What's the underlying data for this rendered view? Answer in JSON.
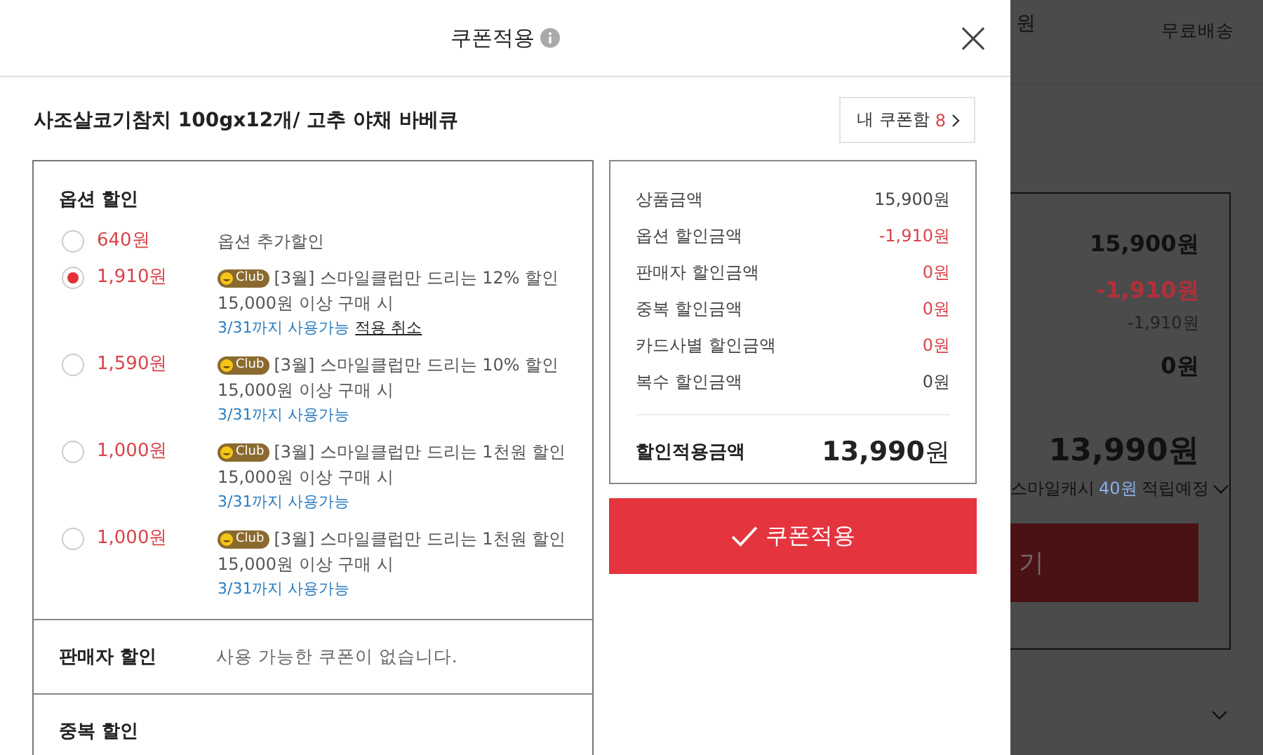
{
  "modal": {
    "title": "쿠폰적용"
  },
  "product": {
    "name": "사조살코기참치 100gx12개/ 고추 야채 바베큐",
    "coupon_box": {
      "label": "내 쿠폰함",
      "count": "8"
    }
  },
  "option_discount": {
    "title": "옵션 할인",
    "coupons": [
      {
        "kind": "plain",
        "selected": false,
        "amount": "640원",
        "name": "옵션 추가할인"
      },
      {
        "kind": "club",
        "selected": true,
        "amount": "1,910원",
        "badge": "Club",
        "name": "[3월] 스마일클럽만 드리는 12% 할인",
        "condition": "15,000원 이상 구매 시",
        "validity": "3/31까지 사용가능",
        "cancel_link": "적용 취소"
      },
      {
        "kind": "club",
        "selected": false,
        "amount": "1,590원",
        "badge": "Club",
        "name": "[3월] 스마일클럽만 드리는 10% 할인",
        "condition": "15,000원 이상 구매 시",
        "validity": "3/31까지 사용가능"
      },
      {
        "kind": "club",
        "selected": false,
        "amount": "1,000원",
        "badge": "Club",
        "name": "[3월] 스마일클럽만 드리는 1천원 할인",
        "condition": "15,000원 이상 구매 시",
        "validity": "3/31까지 사용가능"
      },
      {
        "kind": "club",
        "selected": false,
        "amount": "1,000원",
        "badge": "Club",
        "name": "[3월] 스마일클럽만 드리는 1천원 할인",
        "condition": "15,000원 이상 구매 시",
        "validity": "3/31까지 사용가능"
      }
    ]
  },
  "seller_discount": {
    "title": "판매자 할인",
    "message": "사용 가능한 쿠폰이 없습니다."
  },
  "duplicate_discount": {
    "title": "중복 할인"
  },
  "summary": {
    "rows": [
      {
        "label": "상품금액",
        "value": "15,900원",
        "highlight": false
      },
      {
        "label": "옵션 할인금액",
        "value": "-1,910원",
        "highlight": true
      },
      {
        "label": "판매자 할인금액",
        "value": "0원",
        "highlight": true
      },
      {
        "label": "중복 할인금액",
        "value": "0원",
        "highlight": true
      },
      {
        "label": "카드사별 할인금액",
        "value": "0원",
        "highlight": true
      },
      {
        "label": "복수 할인금액",
        "value": "0원",
        "highlight": false
      }
    ],
    "total": {
      "label": "할인적용금액",
      "amount": "13,990",
      "unit": "원"
    }
  },
  "apply_button": {
    "label": "쿠폰적용"
  },
  "background": {
    "header_fragment": "원",
    "shipping": "무료배송",
    "amounts": [
      {
        "value": "15,900원",
        "kind": "bold"
      },
      {
        "value": "-1,910원",
        "kind": "discount"
      },
      {
        "value": "-1,910원",
        "kind": "sub"
      },
      {
        "value": "0원",
        "kind": "bold"
      }
    ],
    "total": "13,990원",
    "cash_note": {
      "prefix": "스마일캐시",
      "amount": "40원",
      "suffix": "적립예정"
    },
    "button_fragment": "기"
  }
}
